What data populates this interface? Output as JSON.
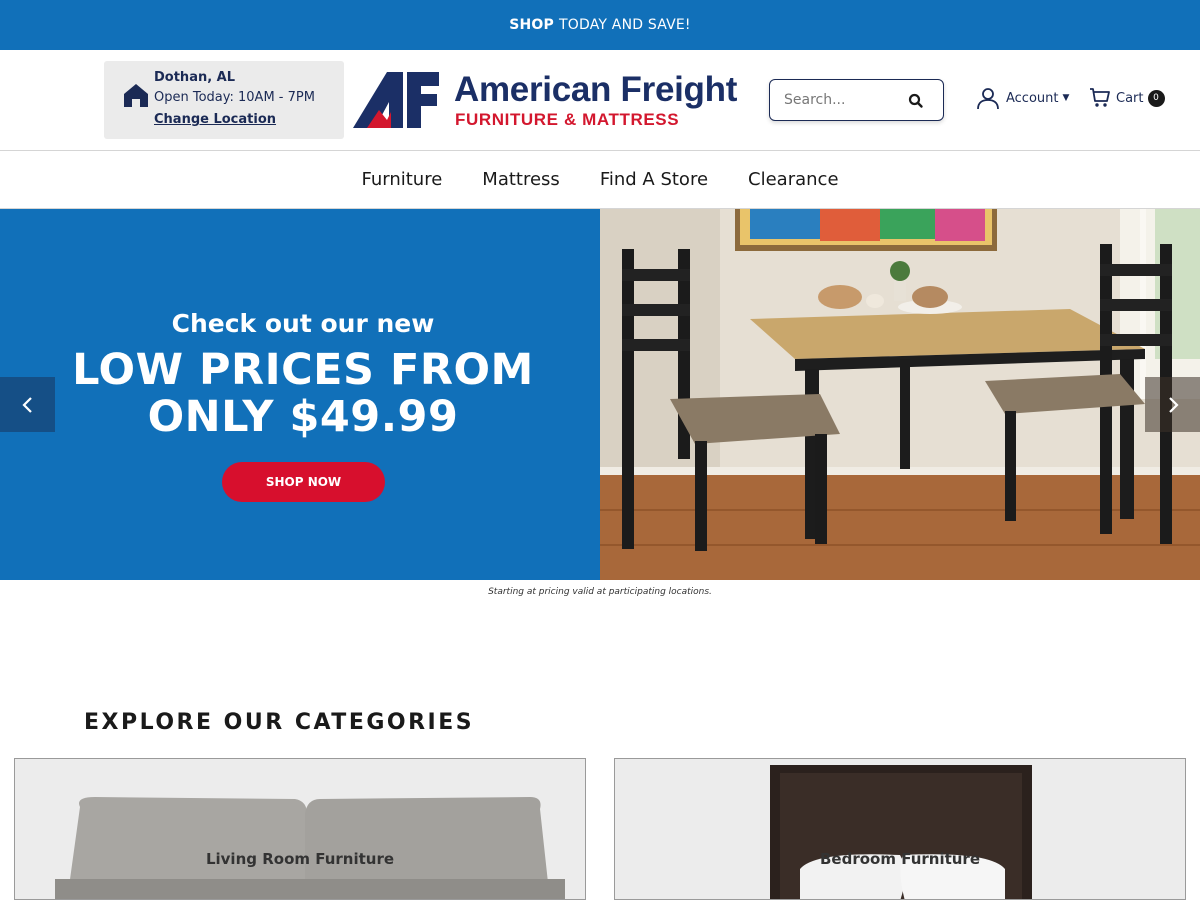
{
  "promo": {
    "bold": "SHOP",
    "text": "TODAY AND SAVE!"
  },
  "store": {
    "city": "Dothan, AL",
    "hours": "Open Today: 10AM - 7PM",
    "change_label": "Change Location"
  },
  "logo": {
    "name": "American Freight",
    "tagline": "FURNITURE & MATTRESS"
  },
  "search": {
    "placeholder": "Search..."
  },
  "account": {
    "label": "Account"
  },
  "cart": {
    "label": "Cart",
    "count": "0"
  },
  "nav": {
    "items": [
      {
        "label": "Furniture"
      },
      {
        "label": "Mattress"
      },
      {
        "label": "Find A Store"
      },
      {
        "label": "Clearance"
      }
    ]
  },
  "hero": {
    "subtitle": "Check out our new",
    "title_line1": "LOW PRICES FROM",
    "title_line2": "ONLY $49.99",
    "cta": "SHOP NOW",
    "disclaimer": "Starting at pricing valid at participating locations."
  },
  "categories": {
    "title": "EXPLORE OUR CATEGORIES",
    "items": [
      {
        "label": "Living Room Furniture"
      },
      {
        "label": "Bedroom Furniture"
      }
    ]
  },
  "colors": {
    "brand_blue": "#1170b9",
    "navy": "#1b2a55",
    "brand_red": "#d3172e",
    "cta_red": "#d70f2d"
  },
  "icons": [
    "home-icon",
    "search-icon",
    "user-icon",
    "caret-down-icon",
    "cart-icon",
    "chevron-left-icon",
    "chevron-right-icon"
  ]
}
